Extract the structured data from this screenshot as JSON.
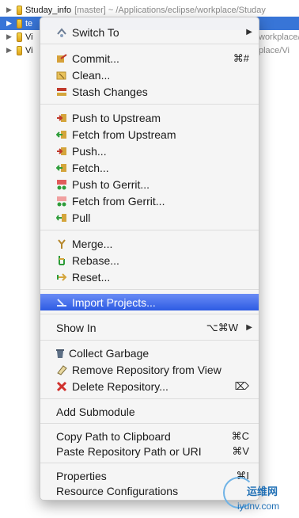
{
  "tree": {
    "rows": [
      {
        "name": "Studay_info",
        "meta": "[master] ~ /Applications/eclipse/workplace/Studay",
        "selected": false
      },
      {
        "name": "te",
        "meta": "",
        "selected": true
      },
      {
        "name": "Vi",
        "meta": "",
        "selected": false
      },
      {
        "name": "Vi",
        "meta": "",
        "selected": false
      }
    ],
    "partial_right": [
      "workplace/V",
      "place/Vi"
    ]
  },
  "menu": {
    "switch_to": {
      "label": "Switch To",
      "icon": "switch-icon"
    },
    "commit": {
      "label": "Commit...",
      "shortcut": "⌘#",
      "icon": "commit-icon"
    },
    "clean": {
      "label": "Clean...",
      "icon": "clean-icon"
    },
    "stash": {
      "label": "Stash Changes",
      "icon": "stash-icon"
    },
    "push_upstream": {
      "label": "Push to Upstream",
      "icon": "push-upstream-icon"
    },
    "fetch_upstream": {
      "label": "Fetch from Upstream",
      "icon": "fetch-upstream-icon"
    },
    "push": {
      "label": "Push...",
      "icon": "push-icon"
    },
    "fetch": {
      "label": "Fetch...",
      "icon": "fetch-icon"
    },
    "push_gerrit": {
      "label": "Push to Gerrit...",
      "icon": "push-gerrit-icon"
    },
    "fetch_gerrit": {
      "label": "Fetch from Gerrit...",
      "icon": "fetch-gerrit-icon"
    },
    "pull": {
      "label": "Pull",
      "icon": "pull-icon"
    },
    "merge": {
      "label": "Merge...",
      "icon": "merge-icon"
    },
    "rebase": {
      "label": "Rebase...",
      "icon": "rebase-icon"
    },
    "reset": {
      "label": "Reset...",
      "icon": "reset-icon"
    },
    "import_projects": {
      "label": "Import Projects...",
      "icon": "import-icon"
    },
    "show_in": {
      "label": "Show In",
      "shortcut": "⌥⌘W"
    },
    "collect_garbage": {
      "label": "Collect Garbage",
      "icon": "trash-icon"
    },
    "remove_repo": {
      "label": "Remove Repository from View",
      "icon": "eraser-icon"
    },
    "delete_repo": {
      "label": "Delete Repository...",
      "icon": "delete-icon",
      "shortcut": "⌦"
    },
    "add_submodule": {
      "label": "Add Submodule"
    },
    "copy_path": {
      "label": "Copy Path to Clipboard",
      "shortcut": "⌘C"
    },
    "paste_path": {
      "label": "Paste Repository Path or URI",
      "shortcut": "⌘V"
    },
    "properties": {
      "label": "Properties",
      "shortcut": "⌘I"
    },
    "resource_config": {
      "label": "Resource Configurations"
    }
  },
  "watermark": {
    "line1": "运维网",
    "line2": "iyunv.com"
  },
  "colors": {
    "highlight": "#2d5be3",
    "selection": "#3875d7"
  }
}
